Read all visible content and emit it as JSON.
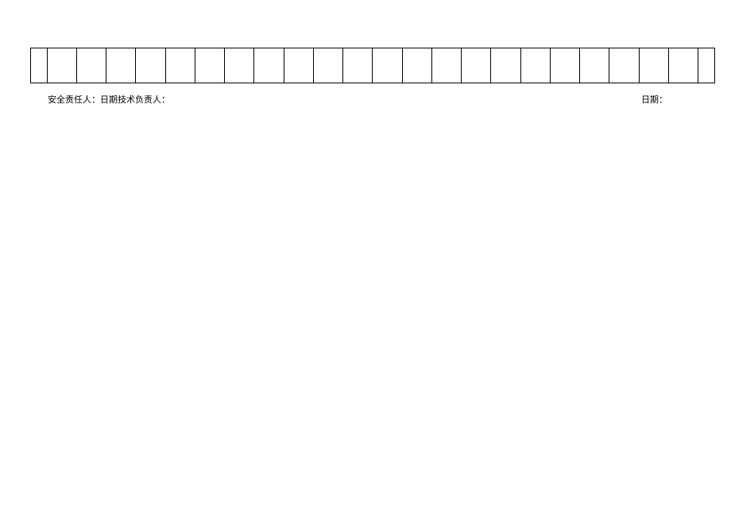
{
  "table": {
    "columns": 24,
    "rows": 1
  },
  "signatures": {
    "left_label": "安全责任人：日期技术负责人：",
    "right_label": "日期："
  }
}
